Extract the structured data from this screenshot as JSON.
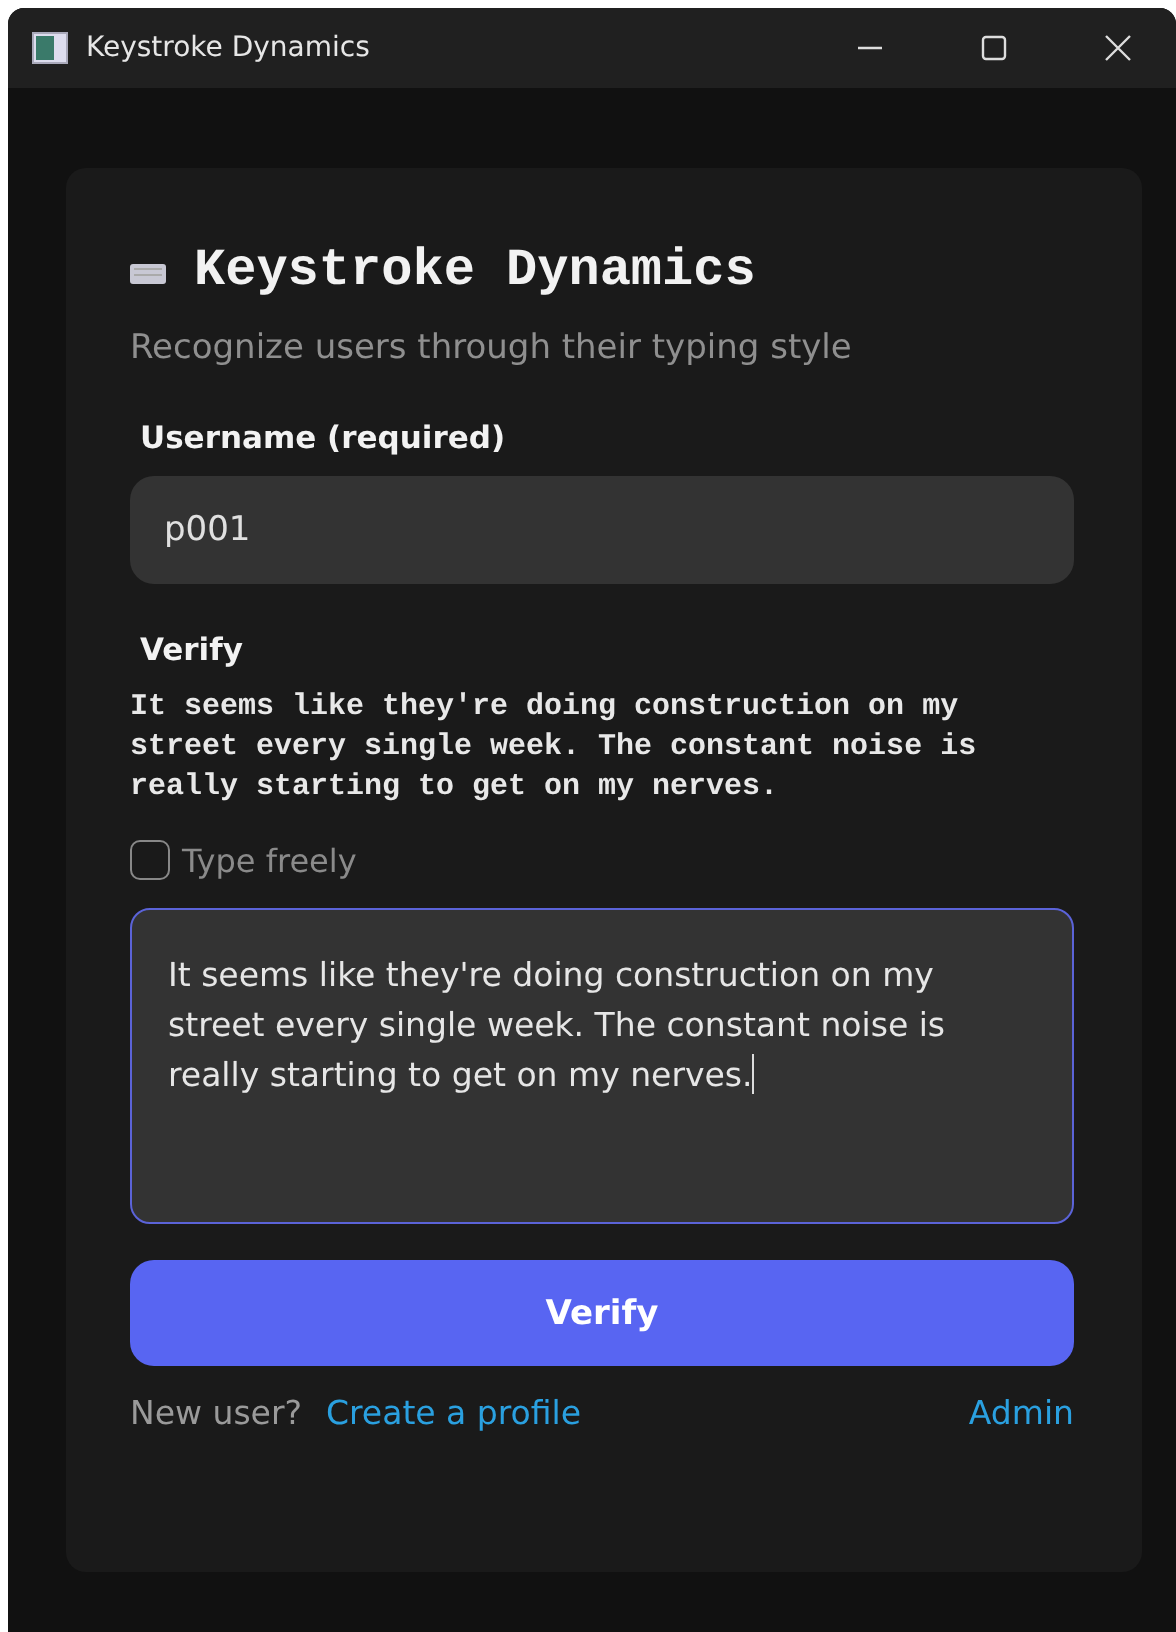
{
  "window": {
    "title": "Keystroke Dynamics"
  },
  "header": {
    "title": "Keystroke Dynamics",
    "subtitle": "Recognize users through their typing style"
  },
  "username": {
    "label": "Username (required)",
    "value": "p001"
  },
  "verify": {
    "label": "Verify",
    "prompt": "It seems like they're doing construction on my street every single week. The constant noise is really starting to get on my nerves.",
    "type_freely": {
      "label": "Type freely",
      "checked": false
    },
    "typed_text": "It seems like they're doing construction on my street every single week. The constant noise is really starting to get on my nerves.",
    "focused": true
  },
  "button": "Verify",
  "footer": {
    "question": "New user?",
    "link": "Create a profile",
    "admin": "Admin"
  }
}
